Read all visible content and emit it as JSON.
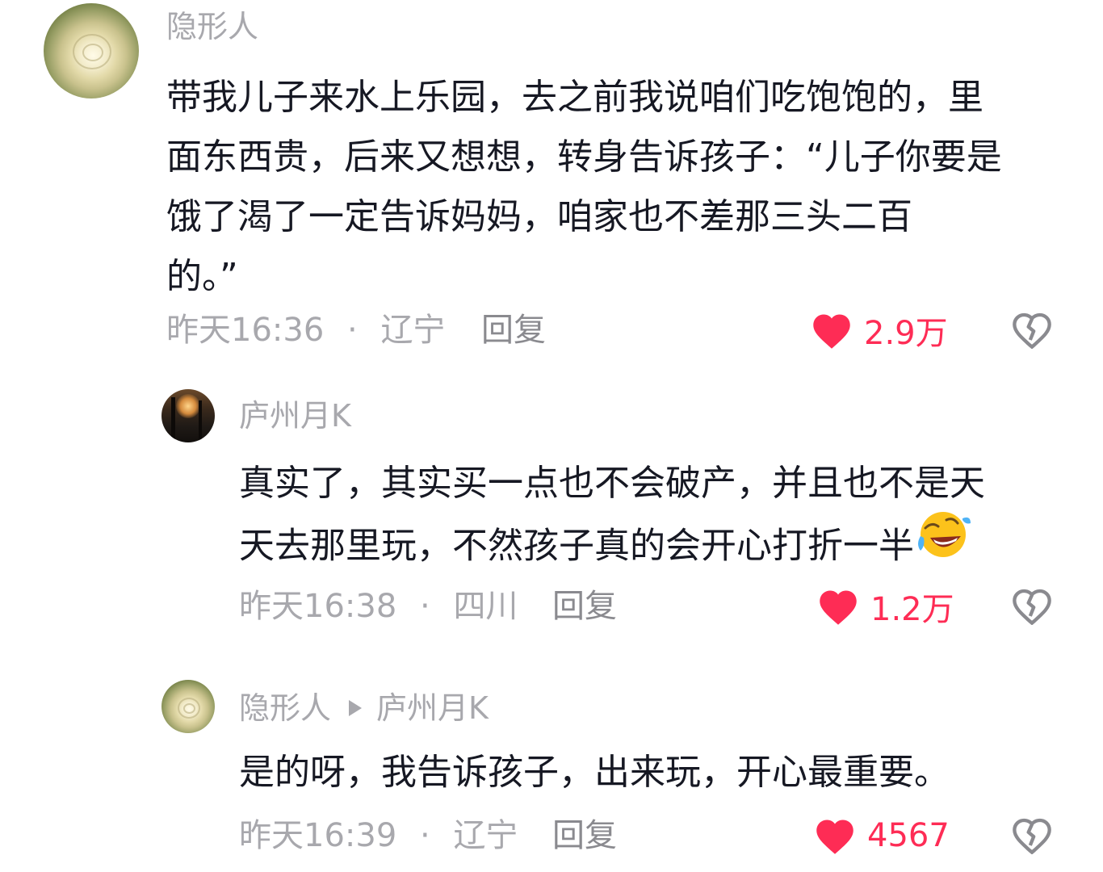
{
  "comments": [
    {
      "username": "隐形人",
      "text_lines": [
        "带我儿子来水上乐园，去之前我说咱们吃饱饱的，里",
        "面东西贵，后来又想想，转身告诉孩子：“儿子你要是",
        "饿了渴了一定告诉妈妈，咱家也不差那三头二百",
        "的。”"
      ],
      "time": "昨天16:36",
      "separator": "·",
      "location": "辽宁",
      "reply_label": "回复",
      "like_count": "2.9万",
      "avatar_icon": "rose-avatar"
    },
    {
      "username": "庐州月K",
      "text_lines": [
        "真实了，其实买一点也不会破产，并且也不是天",
        "天去那里玩，不然孩子真的会开心打折一半"
      ],
      "emoji": "rolling-on-floor-laughing-emoji",
      "time": "昨天16:38",
      "separator": "·",
      "location": "四川",
      "reply_label": "回复",
      "like_count": "1.2万",
      "avatar_icon": "forest-avatar"
    },
    {
      "username": "隐形人",
      "reply_to": "庐州月K",
      "text_lines": [
        "是的呀，我告诉孩子，出来玩，开心最重要。"
      ],
      "time": "昨天16:39",
      "separator": "·",
      "location": "辽宁",
      "reply_label": "回复",
      "like_count": "4567",
      "avatar_icon": "rose-avatar"
    }
  ],
  "colors": {
    "like_red": "#fe2c55",
    "meta_gray": "#a8a8ad",
    "text_dark": "#161823"
  },
  "icons": {
    "like": "heart-icon",
    "dislike": "broken-heart-icon",
    "reply_arrow": "triangle-right-icon"
  }
}
